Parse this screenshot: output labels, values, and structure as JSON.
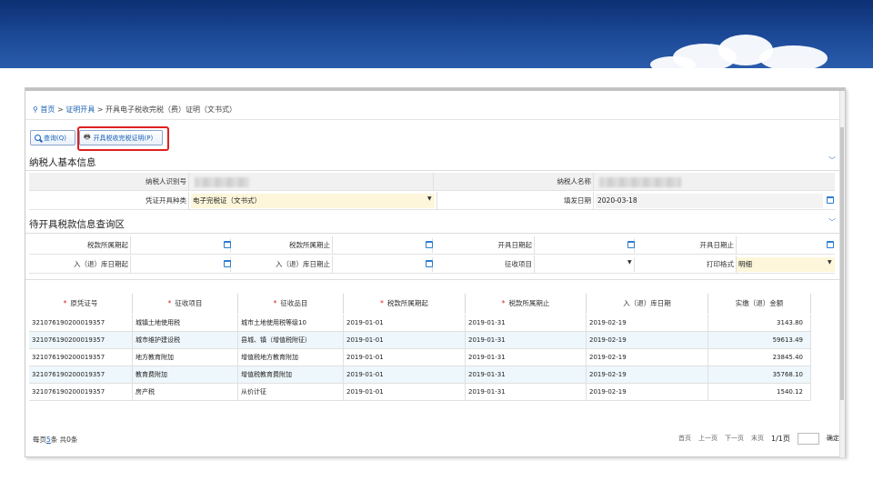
{
  "breadcrumb": {
    "home": "首页",
    "sep1": ">",
    "section": "证明开具",
    "sep2": ">",
    "current": "开具电子税收完税（费）证明（文书式）"
  },
  "toolbar": {
    "query_label": "查询(Q)",
    "issue_label": "开具税收完税证明(P)"
  },
  "taxpayer_section": {
    "title": "纳税人基本信息",
    "id_label": "纳税人识别号",
    "name_label": "纳税人名称",
    "type_label": "凭证开具种类",
    "type_value": "电子完税证（文书式）",
    "fill_date_label": "填发日期",
    "fill_date_value": "2020-03-18"
  },
  "query_section": {
    "title": "待开具税款信息查询区",
    "period_start_label": "税款所属期起",
    "period_end_label": "税款所属期止",
    "issue_start_label": "开具日期起",
    "issue_end_label": "开具日期止",
    "storage_start_label": "入（退）库日期起",
    "storage_end_label": "入（退）库日期止",
    "levy_item_label": "征收项目",
    "print_format_label": "打印格式",
    "print_format_value": "明细"
  },
  "table": {
    "required_mark": "*",
    "headers": [
      "原凭证号",
      "征收项目",
      "征收品目",
      "税款所属期起",
      "税款所属期止",
      "入（退）库日期",
      "实缴（退）金额"
    ],
    "rows": [
      [
        "321076190200019357",
        "城镇土地使用税",
        "城市土地使用税等级10",
        "2019-01-01",
        "2019-01-31",
        "2019-02-19",
        "3143.80"
      ],
      [
        "321076190200019357",
        "城市维护建设税",
        "县城、镇（增值税附征）",
        "2019-01-01",
        "2019-01-31",
        "2019-02-19",
        "59613.49"
      ],
      [
        "321076190200019357",
        "地方教育附加",
        "增值税地方教育附加",
        "2019-01-01",
        "2019-01-31",
        "2019-02-19",
        "23845.40"
      ],
      [
        "321076190200019357",
        "教育费附加",
        "增值税教育费附加",
        "2019-01-01",
        "2019-01-31",
        "2019-02-19",
        "35768.10"
      ],
      [
        "321076190200019357",
        "房产税",
        "从价计征",
        "2019-01-01",
        "2019-01-31",
        "2019-02-19",
        "1540.12"
      ]
    ]
  },
  "footer": {
    "per_page_prefix": "每页",
    "per_page_value": "5",
    "per_page_suffix": "条 共0条",
    "first": "首页",
    "prev": "上一页",
    "next": "下一页",
    "last": "末页",
    "page_info": "1/1页",
    "confirm": "确定"
  },
  "icons": {
    "location": "location-pin-icon",
    "search": "search-icon",
    "print": "printer-icon",
    "calendar": "calendar-icon",
    "dropdown": "caret-down-icon",
    "collapse": "chevron-down-icon"
  },
  "colors": {
    "banner": "#1c4a98",
    "link": "#1a62b5",
    "highlight": "#e02020",
    "editable_bg": "#fdf6da",
    "row_alt": "#eef7fb"
  }
}
